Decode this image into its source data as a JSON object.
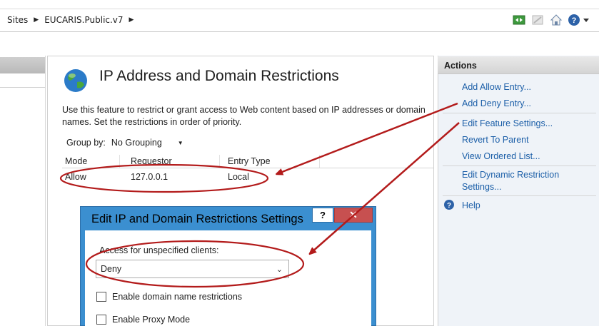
{
  "breadcrumb": {
    "items": [
      "Sites",
      "EUCARIS.Public.v7"
    ]
  },
  "toolbar_icons": [
    "connect-icon",
    "disabled-icon",
    "home-icon",
    "help-dropdown-icon"
  ],
  "feature": {
    "title": "IP Address and Domain Restrictions",
    "description": "Use this feature to restrict or grant access to Web content based on IP addresses or domain names. Set the restrictions in order of priority.",
    "group_by_label": "Group by:",
    "group_by_value": "No Grouping",
    "columns": [
      "Mode",
      "Requestor",
      "Entry Type"
    ],
    "rows": [
      {
        "mode": "Allow",
        "requestor": "127.0.0.1",
        "entry_type": "Local"
      }
    ]
  },
  "dialog": {
    "title": "Edit IP and Domain Restrictions Settings",
    "help_label": "?",
    "close_label": "✕",
    "access_label": "Access for unspecified clients:",
    "access_value": "Deny",
    "checkbox_domain": "Enable domain name restrictions",
    "checkbox_proxy": "Enable Proxy Mode"
  },
  "actions": {
    "title": "Actions",
    "add_allow": "Add Allow Entry...",
    "add_deny": "Add Deny Entry...",
    "edit_feature": "Edit Feature Settings...",
    "revert": "Revert To Parent",
    "view_ordered": "View Ordered List...",
    "edit_dynamic_1": "Edit Dynamic Restriction",
    "edit_dynamic_2": "Settings...",
    "help": "Help"
  },
  "colors": {
    "link": "#1c5fa8",
    "dialog_frame": "#3b8fd0",
    "close_button": "#c75050",
    "annotation": "#b31b1b"
  }
}
